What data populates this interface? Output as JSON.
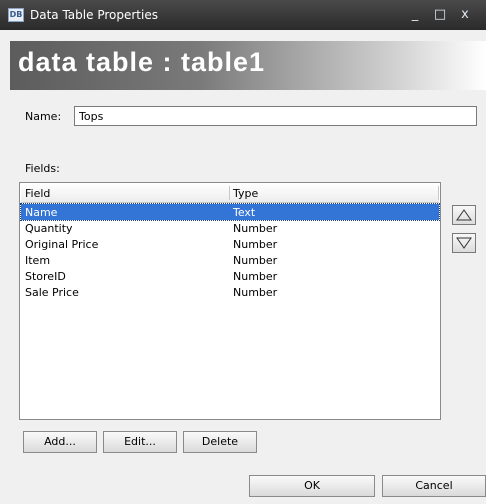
{
  "window": {
    "title": "Data Table Properties",
    "app_icon_text": "DB",
    "minimize_glyph": "_",
    "maximize_glyph": "□",
    "close_glyph": "x"
  },
  "banner": {
    "text": "data table : table1"
  },
  "name_field": {
    "label": "Name:",
    "value": "Tops"
  },
  "fields": {
    "label": "Fields:",
    "columns": [
      "Field",
      "Type"
    ],
    "rows": [
      {
        "field": "Name",
        "type": "Text",
        "selected": true
      },
      {
        "field": "Quantity",
        "type": "Number",
        "selected": false
      },
      {
        "field": "Original Price",
        "type": "Number",
        "selected": false
      },
      {
        "field": "Item",
        "type": "Number",
        "selected": false
      },
      {
        "field": "StoreID",
        "type": "Number",
        "selected": false
      },
      {
        "field": "Sale Price",
        "type": "Number",
        "selected": false
      }
    ]
  },
  "buttons": {
    "add": "Add...",
    "edit": "Edit...",
    "delete": "Delete",
    "ok": "OK",
    "cancel": "Cancel"
  },
  "icons": {
    "move_up": "triangle-up-icon",
    "move_down": "triangle-down-icon"
  },
  "colors": {
    "selection": "#3375d6",
    "titlebar": "#2f2f2f"
  }
}
